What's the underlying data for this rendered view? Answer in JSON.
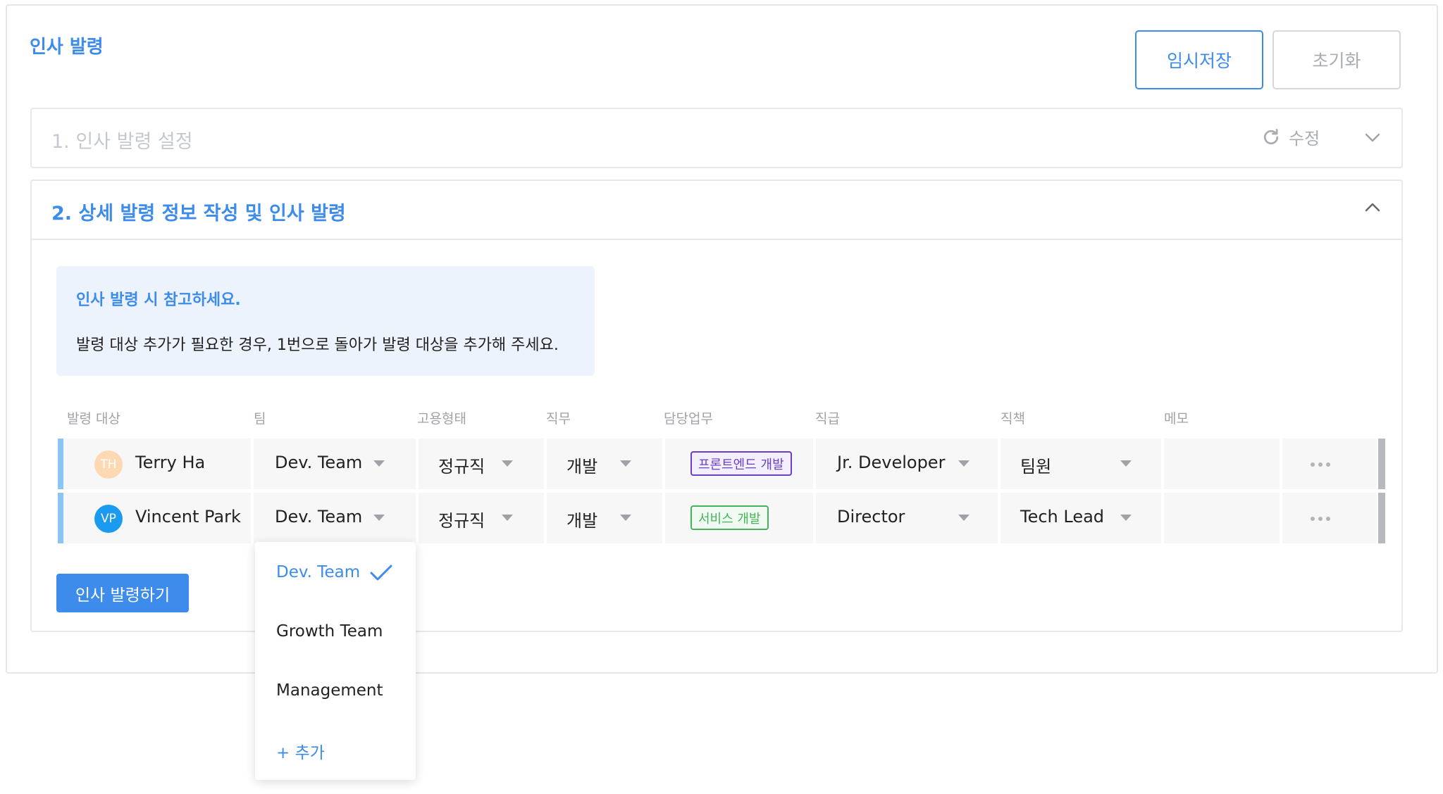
{
  "page": {
    "title": "인사 발령"
  },
  "toolbar": {
    "save_label": "임시저장",
    "reset_label": "초기화"
  },
  "section1": {
    "title": "1. 인사 발령 설정",
    "edit_label": "수정"
  },
  "section2": {
    "title": "2. 상세 발령 정보 작성 및 인사 발령"
  },
  "notice": {
    "title": "인사 발령 시 참고하세요.",
    "body": "발령 대상 추가가 필요한 경우, 1번으로 돌아가 발령 대상을 추가해 주세요."
  },
  "table": {
    "columns": [
      "발령 대상",
      "팀",
      "고용형태",
      "직무",
      "담당업무",
      "직급",
      "직책",
      "메모"
    ],
    "rows": [
      {
        "initials": "TH",
        "name": "Terry Ha",
        "team": "Dev. Team",
        "employment": "정규직",
        "job": "개발",
        "duty": "프론트엔드 개발",
        "grade": "Jr. Developer",
        "position": "팀원",
        "memo": ""
      },
      {
        "initials": "VP",
        "name": "Vincent Park",
        "team": "Dev. Team",
        "employment": "정규직",
        "job": "개발",
        "duty": "서비스 개발",
        "grade": "Director",
        "position": "Tech Lead",
        "memo": ""
      }
    ]
  },
  "issue_button": {
    "label": "인사 발령하기"
  },
  "team_dropdown": {
    "options": [
      "Dev. Team",
      "Growth Team",
      "Management"
    ],
    "selected": "Dev. Team",
    "add_label": "+ 추가"
  },
  "colors": {
    "accent": "#3d8bea",
    "row_accent": "#8cc4f2",
    "avatar_th": "#fcd9b3",
    "avatar_vp": "#1a9bf0",
    "tag_frontend": "#6a3fc9",
    "tag_service": "#45b35a"
  }
}
